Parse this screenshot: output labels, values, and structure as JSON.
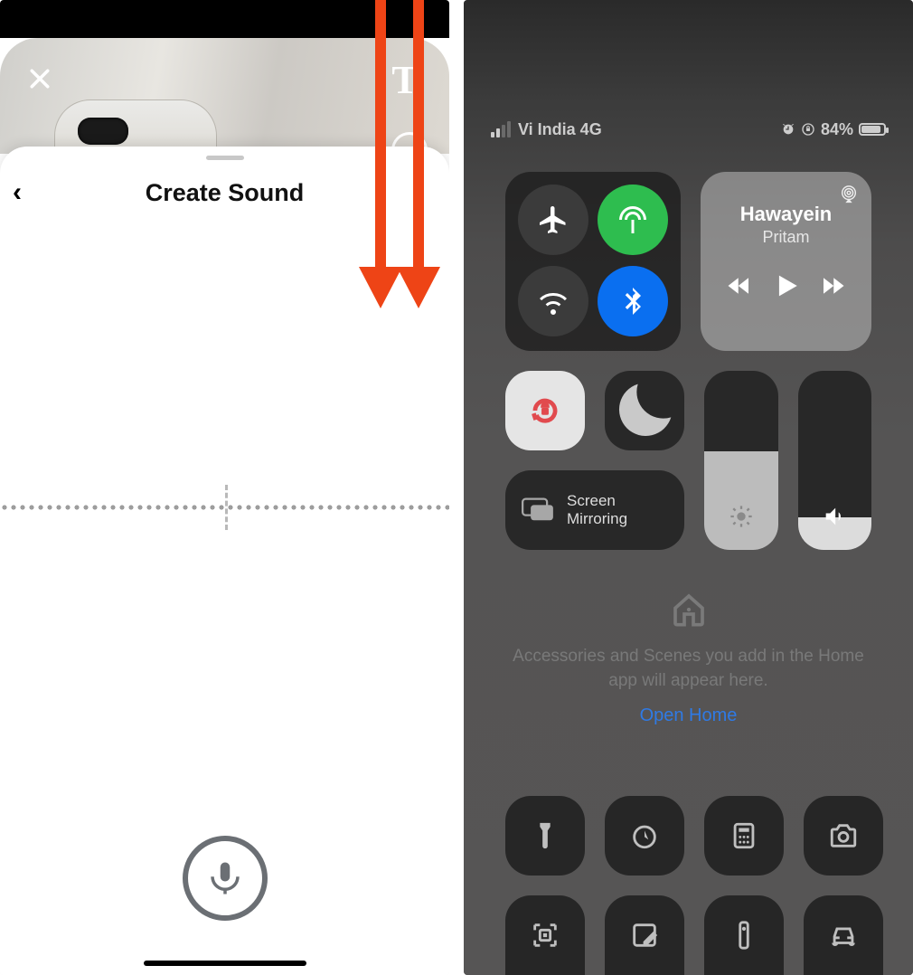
{
  "left": {
    "sheet_title": "Create Sound",
    "close_label": "Close",
    "text_tool_glyph": "T",
    "back_glyph": "‹",
    "mic_label": "Record"
  },
  "arrows": {
    "hint": "Swipe down"
  },
  "right": {
    "status": {
      "carrier": "Vi India 4G",
      "battery_percent": "84%",
      "alarm": "⏰",
      "orientation_lock": "⊘"
    },
    "connectivity": {
      "airplane": "airplane-icon",
      "cellular": "antenna-icon",
      "wifi": "wifi-icon",
      "bluetooth": "bluetooth-icon"
    },
    "media": {
      "track": "Hawayein",
      "artist": "Pritam"
    },
    "orientation_lock_tile": "orientation-lock-icon",
    "dnd_tile": "moon-icon",
    "screen_mirroring_label": "Screen\nMirroring",
    "brightness_percent": 55,
    "volume_percent": 18,
    "home": {
      "message": "Accessories and Scenes you add in the Home app will appear here.",
      "open_label": "Open Home"
    },
    "bottom_row1": [
      "flashlight-icon",
      "timer-icon",
      "calculator-icon",
      "camera-icon"
    ],
    "bottom_row2": [
      "qr-icon",
      "notes-icon",
      "remote-icon",
      "car-icon"
    ]
  }
}
